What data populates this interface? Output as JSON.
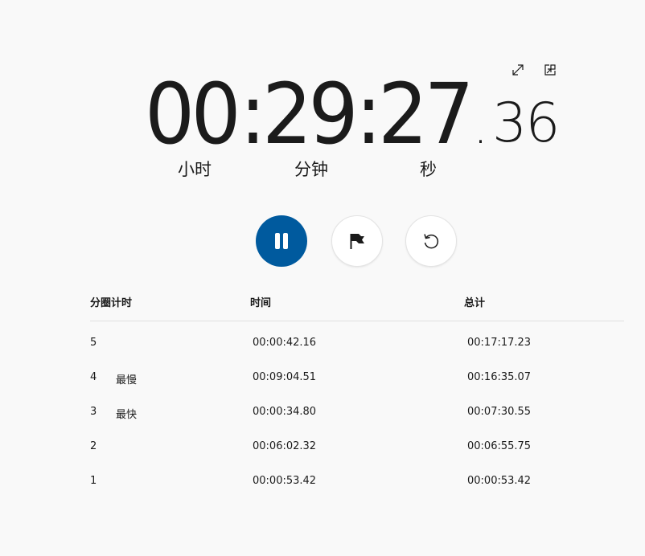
{
  "timer": {
    "hours": "00",
    "sep1": ":",
    "minutes": "29",
    "sep2": ":",
    "seconds": "27",
    "dot": ".",
    "fraction": "36",
    "unit_hours": "小时",
    "unit_minutes": "分钟",
    "unit_seconds": "秒"
  },
  "controls": {
    "pause_icon": "pause-icon",
    "lap_icon": "flag-icon",
    "reset_icon": "reset-icon",
    "pause_color": "#005a9e"
  },
  "window_icons": [
    "expand-icon",
    "compact-overlay-icon"
  ],
  "laps": {
    "headers": {
      "lap": "分圈计时",
      "time": "时间",
      "total": "总计"
    },
    "rows": [
      {
        "number": "5",
        "tag": "",
        "time": "00:00:42.16",
        "total": "00:17:17.23"
      },
      {
        "number": "4",
        "tag": "最慢",
        "time": "00:09:04.51",
        "total": "00:16:35.07"
      },
      {
        "number": "3",
        "tag": "最快",
        "time": "00:00:34.80",
        "total": "00:07:30.55"
      },
      {
        "number": "2",
        "tag": "",
        "time": "00:06:02.32",
        "total": "00:06:55.75"
      },
      {
        "number": "1",
        "tag": "",
        "time": "00:00:53.42",
        "total": "00:00:53.42"
      }
    ]
  }
}
